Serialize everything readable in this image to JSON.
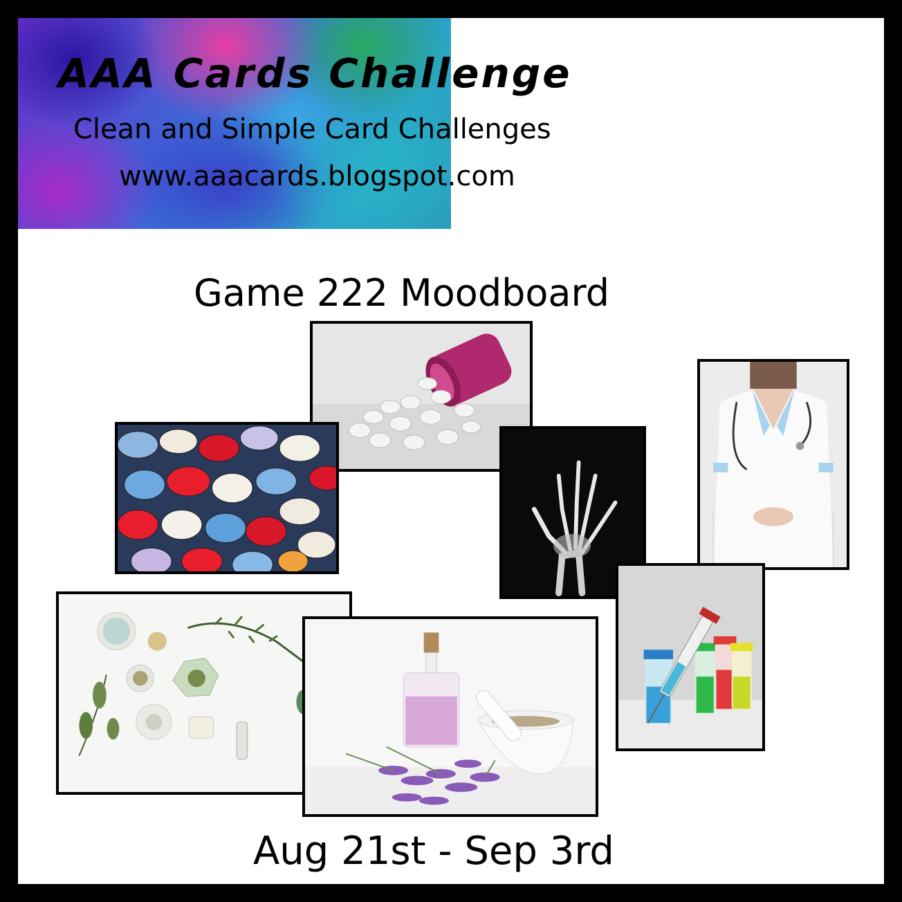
{
  "header": {
    "title": "AAA Cards Challenge",
    "subtitle": "Clean and Simple Card Challenges",
    "url": "www.aaacards.blogspot.com"
  },
  "moodboard": {
    "heading": "Game 222 Moodboard",
    "dates": "Aug 21st - Sep 3rd",
    "photos": [
      {
        "id": "pills-bottle",
        "subject": "white pills spilling from pink bottle"
      },
      {
        "id": "colorful-pills",
        "subject": "colorful pills"
      },
      {
        "id": "xray-hand",
        "subject": "x-ray of hand"
      },
      {
        "id": "nurse",
        "subject": "nurse with stethoscope"
      },
      {
        "id": "herbs",
        "subject": "herbs and powders in bowls"
      },
      {
        "id": "lavender-mortar",
        "subject": "lavender oil bottle with mortar and pestle"
      },
      {
        "id": "syringe-vials",
        "subject": "syringe and colored vials"
      }
    ]
  },
  "colors": {
    "frame": "#000000",
    "background": "#ffffff",
    "photo_border": "#000000"
  }
}
